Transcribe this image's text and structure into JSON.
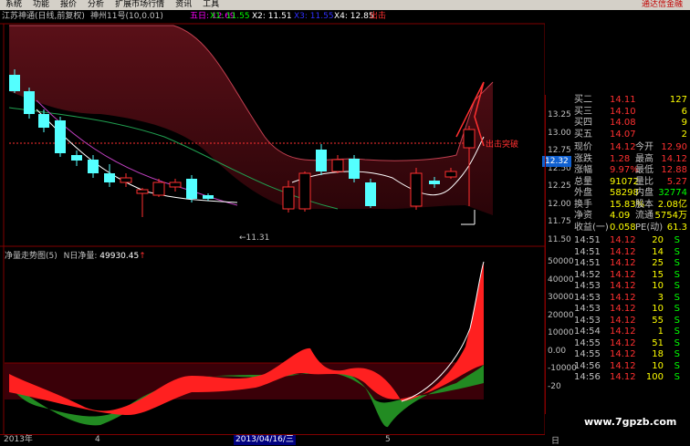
{
  "menu": [
    "系统",
    "功能",
    "报价",
    "分析",
    "扩展市场行情",
    "资讯",
    "工具"
  ],
  "brand": "通达信金融",
  "header": {
    "stock": "江苏神通(日线,前复权)",
    "indicator": "神州11号(10,0.01)",
    "items": [
      {
        "text": "五日: 12.69",
        "color": "#ff00ff"
      },
      {
        "text": "X1: 11.55",
        "color": "#00ff00"
      },
      {
        "text": "X2: 11.51",
        "color": "#ffffff"
      },
      {
        "text": "X3: 11.55",
        "color": "#3030ff"
      },
      {
        "text": "X4: 12.85",
        "color": "#ffffff"
      },
      {
        "text": "出击",
        "color": "#ff3030"
      }
    ]
  },
  "main_chart": {
    "price_ticks": [
      "13.25",
      "13.00",
      "12.75",
      "12.50",
      "12.25",
      "12.00",
      "11.75",
      "11.50"
    ],
    "current_price": "12.32",
    "breakout_label": "出击突破",
    "low_label": "←11.31"
  },
  "sub_chart": {
    "title": "净量走势图(5)",
    "label": "N日净量:",
    "value": "49930.45",
    "ticks": [
      "50000",
      "40000",
      "30000",
      "20000",
      "10000",
      "0.00",
      "-10000",
      "-20"
    ]
  },
  "time_axis": [
    "2013年",
    "4",
    "2013/04/16/三",
    "5"
  ],
  "day_tab": "日",
  "order_book": [
    {
      "label": "买二",
      "price": "14.11",
      "vol": "127"
    },
    {
      "label": "买三",
      "price": "14.10",
      "vol": "6"
    },
    {
      "label": "买四",
      "price": "14.08",
      "vol": "9"
    },
    {
      "label": "买五",
      "price": "14.07",
      "vol": "2"
    }
  ],
  "stats": [
    [
      "现价",
      "14.12",
      "今开",
      "12.90"
    ],
    [
      "涨跌",
      "1.28",
      "最高",
      "14.12"
    ],
    [
      "涨幅",
      "9.97%",
      "最低",
      "12.88"
    ],
    [
      "总量",
      "91072",
      "量比",
      "5.27"
    ],
    [
      "外盘",
      "58298",
      "内盘",
      "32774"
    ],
    [
      "换手",
      "15.83%",
      "股本",
      "2.08亿"
    ],
    [
      "净资",
      "4.09",
      "流通",
      "5754万"
    ],
    [
      "收益(一)",
      "0.058",
      "PE(动)",
      "61.3"
    ]
  ],
  "trades": [
    [
      "14:51",
      "14.12",
      "20",
      "S"
    ],
    [
      "14:51",
      "14.12",
      "14",
      "S"
    ],
    [
      "14:51",
      "14.12",
      "25",
      "S"
    ],
    [
      "14:52",
      "14.12",
      "15",
      "S"
    ],
    [
      "14:53",
      "14.12",
      "10",
      "S"
    ],
    [
      "14:53",
      "14.12",
      "3",
      "S"
    ],
    [
      "14:53",
      "14.12",
      "10",
      "S"
    ],
    [
      "14:53",
      "14.12",
      "55",
      "S"
    ],
    [
      "14:54",
      "14.12",
      "1",
      "S"
    ],
    [
      "14:55",
      "14.12",
      "51",
      "S"
    ],
    [
      "14:55",
      "14.12",
      "18",
      "S"
    ],
    [
      "14:56",
      "14.12",
      "10",
      "S"
    ],
    [
      "14:56",
      "14.12",
      "100",
      "S"
    ]
  ],
  "watermark": "www.7gpzb.com"
}
